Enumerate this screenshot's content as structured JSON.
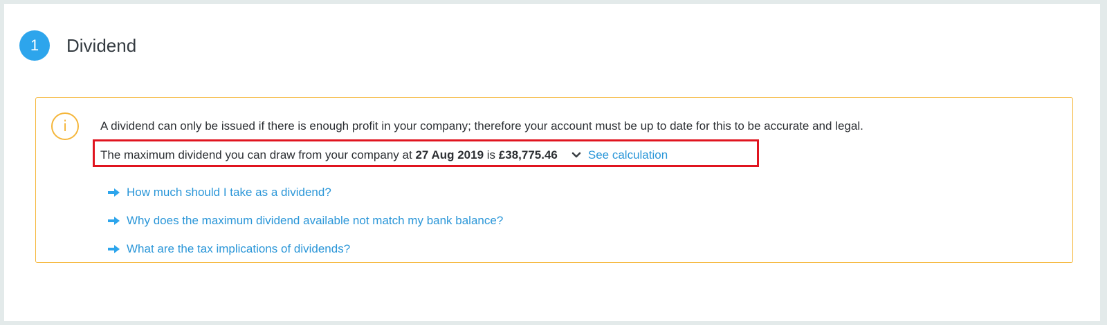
{
  "step": {
    "number": "1",
    "title": "Dividend"
  },
  "info": {
    "icon": "info-icon",
    "icon_glyph": "i",
    "accent_color": "#f5b63a",
    "message": "A dividend can only be issued if there is enough profit in your company; therefore your account must be up to date for this to be accurate and legal.",
    "max_prefix": "The maximum dividend you can draw from your company at",
    "max_date": "27 Aug 2019",
    "max_is": "is",
    "max_amount": "£38,775.46",
    "see_calculation": "See calculation"
  },
  "links": [
    {
      "label": "How much should I take as a dividend?",
      "icon": "arrow-right-icon"
    },
    {
      "label": "Why does the maximum dividend available not match my bank balance?",
      "icon": "arrow-right-icon"
    },
    {
      "label": "What are the tax implications of dividends?",
      "icon": "arrow-right-icon"
    }
  ],
  "colors": {
    "badge": "#2da5ec",
    "link": "#2a96d8",
    "highlight": "#e0141f"
  }
}
